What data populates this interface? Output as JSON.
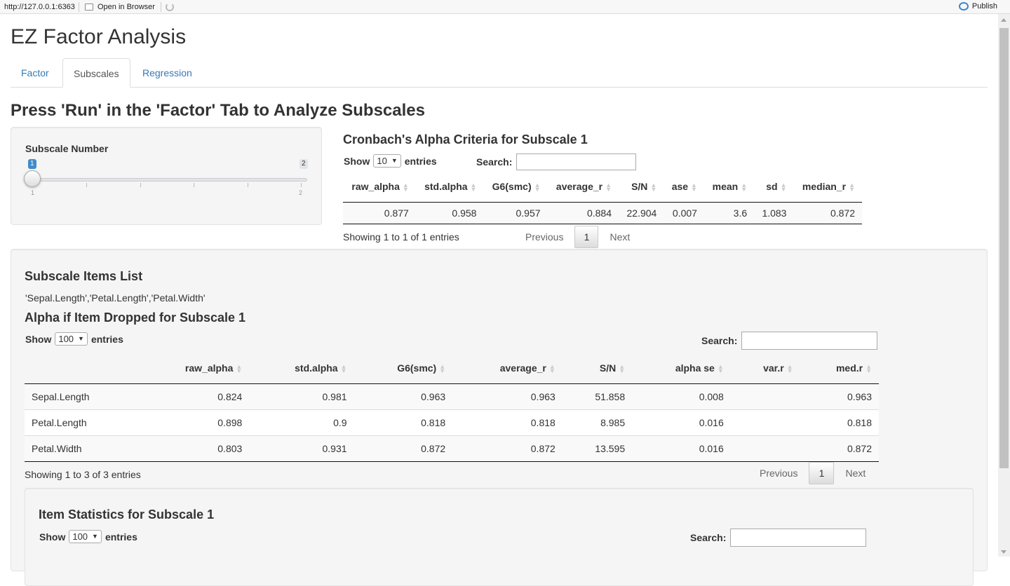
{
  "browser": {
    "url": "http://127.0.0.1:6363",
    "open_in_browser": "Open in Browser",
    "publish": "Publish"
  },
  "app": {
    "title": "EZ Factor Analysis",
    "tabs": [
      {
        "label": "Factor",
        "active": false
      },
      {
        "label": "Subscales",
        "active": true
      },
      {
        "label": "Regression",
        "active": false
      }
    ],
    "heading": "Press 'Run' in the 'Factor' Tab to Analyze Subscales"
  },
  "slider": {
    "label": "Subscale Number",
    "value": 1,
    "min": 1,
    "max": 2,
    "min_label": "1",
    "max_label": "2",
    "value_label": "1",
    "tick_min_label": "1",
    "tick_max_label": "2"
  },
  "alpha_table": {
    "title": "Cronbach's Alpha Criteria for Subscale 1",
    "show_label": "Show",
    "length": "10",
    "entries_label": "entries",
    "search_label": "Search:",
    "columns": [
      "raw_alpha",
      "std.alpha",
      "G6(smc)",
      "average_r",
      "S/N",
      "ase",
      "mean",
      "sd",
      "median_r"
    ],
    "rows": [
      [
        "0.877",
        "0.958",
        "0.957",
        "0.884",
        "22.904",
        "0.007",
        "3.6",
        "1.083",
        "0.872"
      ]
    ],
    "info": "Showing 1 to 1 of 1 entries",
    "previous": "Previous",
    "page": "1",
    "next": "Next"
  },
  "items": {
    "title": "Subscale Items List",
    "list": "'Sepal.Length','Petal.Length','Petal.Width'"
  },
  "dropped_table": {
    "title": "Alpha if Item Dropped for Subscale 1",
    "show_label": "Show",
    "length": "100",
    "entries_label": "entries",
    "search_label": "Search:",
    "columns": [
      "",
      "raw_alpha",
      "std.alpha",
      "G6(smc)",
      "average_r",
      "S/N",
      "alpha se",
      "var.r",
      "med.r"
    ],
    "rows": [
      [
        "Sepal.Length",
        "0.824",
        "0.981",
        "0.963",
        "0.963",
        "51.858",
        "0.008",
        "",
        "0.963"
      ],
      [
        "Petal.Length",
        "0.898",
        "0.9",
        "0.818",
        "0.818",
        "8.985",
        "0.016",
        "",
        "0.818"
      ],
      [
        "Petal.Width",
        "0.803",
        "0.931",
        "0.872",
        "0.872",
        "13.595",
        "0.016",
        "",
        "0.872"
      ]
    ],
    "info": "Showing 1 to 3 of 3 entries",
    "previous": "Previous",
    "page": "1",
    "next": "Next"
  },
  "item_stats": {
    "title": "Item Statistics for Subscale 1",
    "show_label": "Show",
    "length": "100",
    "entries_label": "entries",
    "search_label": "Search:"
  }
}
